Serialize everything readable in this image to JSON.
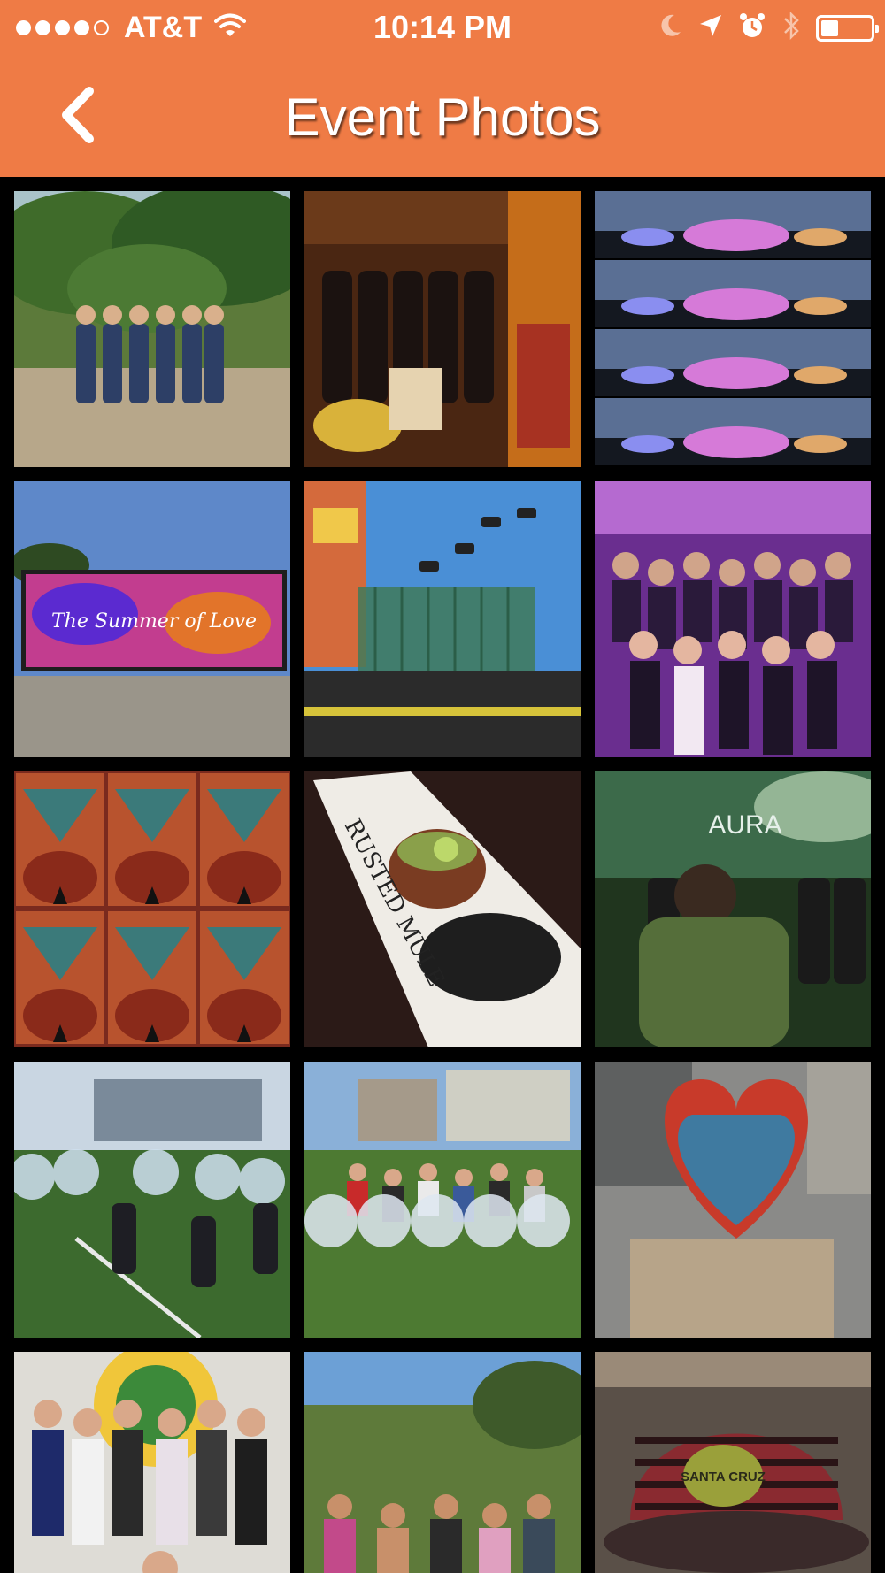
{
  "status_bar": {
    "carrier": "AT&T",
    "time": "10:14 PM",
    "signal_bars_filled": 4,
    "signal_bars_total": 5,
    "battery_level": 0.35,
    "icons": [
      "wifi-icon",
      "moon-icon",
      "location-arrow-icon",
      "alarm-icon",
      "bluetooth-icon",
      "battery-icon"
    ]
  },
  "nav": {
    "title": "Event Photos",
    "back_icon": "chevron-left-icon"
  },
  "colors": {
    "accent": "#EF7B45",
    "background": "#000000"
  },
  "photos": [
    {
      "name": "photo-group-hike-trees",
      "scene": "forest",
      "text": ""
    },
    {
      "name": "photo-crowded-bar",
      "scene": "bar",
      "text": ""
    },
    {
      "name": "photo-conservatory-lights-collage",
      "scene": "night-collage",
      "text": ""
    },
    {
      "name": "photo-summer-of-love-billboard",
      "scene": "billboard",
      "text": "The Summer of Love"
    },
    {
      "name": "photo-carnival-swing-ride",
      "scene": "carnival",
      "text": ""
    },
    {
      "name": "photo-group-purple-party",
      "scene": "purple-party",
      "text": ""
    },
    {
      "name": "photo-painted-art-collage",
      "scene": "art-collage",
      "text": ""
    },
    {
      "name": "photo-rusted-mule-drink",
      "scene": "drink",
      "text": "RUSTED MULE"
    },
    {
      "name": "photo-aura-nightclub",
      "scene": "club",
      "text": "AURA"
    },
    {
      "name": "photo-bubble-soccer-field",
      "scene": "field",
      "text": ""
    },
    {
      "name": "photo-bubble-soccer-group",
      "scene": "field-group",
      "text": ""
    },
    {
      "name": "photo-heart-sculpture",
      "scene": "heart",
      "text": ""
    },
    {
      "name": "photo-group-gym-fists",
      "scene": "gym",
      "text": ""
    },
    {
      "name": "photo-group-hike-overlook",
      "scene": "overlook",
      "text": ""
    },
    {
      "name": "photo-santa-cruz-hat",
      "scene": "hat",
      "text": "SANTA CRUZ"
    }
  ]
}
